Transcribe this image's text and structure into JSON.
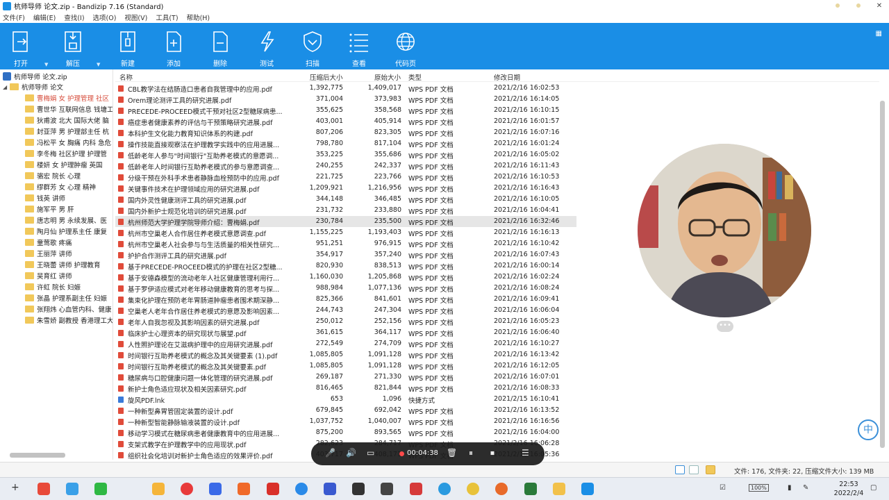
{
  "window": {
    "title": "杭师导师 论文.zip - Bandizip 7.16 (Standard)"
  },
  "menu": [
    "文件(F)",
    "编辑(E)",
    "查找(I)",
    "选项(O)",
    "视图(V)",
    "工具(T)",
    "帮助(H)"
  ],
  "toolbar": {
    "buttons": [
      {
        "label": "打开",
        "icon": "open-icon"
      },
      {
        "label": "解压",
        "icon": "extract-icon"
      },
      {
        "label": "新建",
        "icon": "new-archive-icon"
      },
      {
        "label": "添加",
        "icon": "add-icon"
      },
      {
        "label": "删除",
        "icon": "delete-icon"
      },
      {
        "label": "测试",
        "icon": "test-icon"
      },
      {
        "label": "扫描",
        "icon": "scan-icon"
      },
      {
        "label": "查看",
        "icon": "view-icon"
      },
      {
        "label": "代码页",
        "icon": "codepage-icon"
      }
    ],
    "color": "#1a8ee6"
  },
  "tree": {
    "root": "杭师导师 论文.zip",
    "folder": "杭师导师 论文",
    "items": [
      "曹梅娟 女 护理管理 社区",
      "曹世华 互联网信息 钱塘工",
      "狄甫波 北大 国际大佬 脑",
      "封亚萍 男 护理部主任 杭",
      "冯松平 女 胸痛 内科 急危",
      "李冬梅 社区护理 护理管",
      "楼妍 女 护理肿瘤 英国",
      "骆宏 院长 心理",
      "缪群芳 女 心理 精神",
      "钱英 讲师",
      "施军平 男 肝",
      "唐志明 男 永续发展、医",
      "陶月仙 护理系主任 康复",
      "童莺歌 疼痛",
      "王丽萍 讲师",
      "王晓蕾 讲师 护理教育",
      "吴育红 讲师",
      "许虹 院长 妇娠",
      "张晶 护理系副主任 妇娠",
      "张翔炜 心血管内科、健康",
      "朱雪娇 副教授 香港理工大"
    ]
  },
  "columns": {
    "name": "名称",
    "csize": "压缩后大小",
    "osize": "原始大小",
    "type": "类型",
    "date": "修改日期"
  },
  "files": [
    {
      "name": "CBL教学法在结肠造口患者自我管理中的应用.pdf",
      "csize": "1,392,775",
      "osize": "1,409,017",
      "type": "WPS PDF 文档",
      "date": "2021/2/16 16:02:53"
    },
    {
      "name": "Orem理论测评工具的研究进展.pdf",
      "csize": "371,004",
      "osize": "373,983",
      "type": "WPS PDF 文档",
      "date": "2021/2/16 16:14:05"
    },
    {
      "name": "PRECEDE-PROCEED模式干预对社区2型糖尿病患...",
      "csize": "355,625",
      "osize": "358,568",
      "type": "WPS PDF 文档",
      "date": "2021/2/16 16:10:15"
    },
    {
      "name": "癌症患者健康素养的评估与干预策略研究进展.pdf",
      "csize": "403,001",
      "osize": "405,914",
      "type": "WPS PDF 文档",
      "date": "2021/2/16 16:01:57"
    },
    {
      "name": "本科护生文化能力教育知识体系的构建.pdf",
      "csize": "807,206",
      "osize": "823,305",
      "type": "WPS PDF 文档",
      "date": "2021/2/16 16:07:16"
    },
    {
      "name": "操作技能直接观察法在护理教学实践中的应用进展...",
      "csize": "798,780",
      "osize": "817,104",
      "type": "WPS PDF 文档",
      "date": "2021/2/16 16:01:24"
    },
    {
      "name": "低龄老年人参与\"时间银行\"互助养老模式的意愿调...",
      "csize": "353,225",
      "osize": "355,686",
      "type": "WPS PDF 文档",
      "date": "2021/2/16 16:05:02"
    },
    {
      "name": "低龄老年人时间银行互助养老模式的参与意愿调查...",
      "csize": "240,255",
      "osize": "242,337",
      "type": "WPS PDF 文档",
      "date": "2021/2/16 16:11:43"
    },
    {
      "name": "分级干预在外科手术患者静脉血栓预防中的应用.pdf",
      "csize": "221,725",
      "osize": "223,766",
      "type": "WPS PDF 文档",
      "date": "2021/2/16 16:10:53"
    },
    {
      "name": "关键事件技术在护理领域应用的研究进展.pdf",
      "csize": "1,209,921",
      "osize": "1,216,956",
      "type": "WPS PDF 文档",
      "date": "2021/2/16 16:16:43"
    },
    {
      "name": "国内外灵性健康测评工具的研究进展.pdf",
      "csize": "344,148",
      "osize": "346,485",
      "type": "WPS PDF 文档",
      "date": "2021/2/16 16:10:05"
    },
    {
      "name": "国内外新护士规范化培训的研究进展.pdf",
      "csize": "231,732",
      "osize": "233,880",
      "type": "WPS PDF 文档",
      "date": "2021/2/16 16:04:41"
    },
    {
      "name": "杭州师范大学护理学院导师介绍：曹梅娟.pdf",
      "csize": "230,784",
      "osize": "235,500",
      "type": "WPS PDF 文档",
      "date": "2021/2/16 16:32:46"
    },
    {
      "name": "杭州市空巢老人合作居住养老模式意愿调查.pdf",
      "csize": "1,155,225",
      "osize": "1,193,403",
      "type": "WPS PDF 文档",
      "date": "2021/2/16 16:16:13"
    },
    {
      "name": "杭州市空巢老人社会参与与生活质量的相关性研究...",
      "csize": "951,251",
      "osize": "976,915",
      "type": "WPS PDF 文档",
      "date": "2021/2/16 16:10:42"
    },
    {
      "name": "护护合作测评工具的研究进展.pdf",
      "csize": "354,917",
      "osize": "357,240",
      "type": "WPS PDF 文档",
      "date": "2021/2/16 16:07:43"
    },
    {
      "name": "基于PRECEDE-PROCEED模式的护理在社区2型糖...",
      "csize": "820,930",
      "osize": "838,513",
      "type": "WPS PDF 文档",
      "date": "2021/2/16 16:00:14"
    },
    {
      "name": "基于安德森模型的流动老年人社区健康管理利用行...",
      "csize": "1,160,030",
      "osize": "1,205,868",
      "type": "WPS PDF 文档",
      "date": "2021/2/16 16:02:24"
    },
    {
      "name": "基于罗伊适应模式对老年移动健康教育的思考与探...",
      "csize": "988,984",
      "osize": "1,077,136",
      "type": "WPS PDF 文档",
      "date": "2021/2/16 16:08:24"
    },
    {
      "name": "集束化护理在预防老年胃肠道肿瘤患者围术期深静...",
      "csize": "825,366",
      "osize": "841,601",
      "type": "WPS PDF 文档",
      "date": "2021/2/16 16:09:41"
    },
    {
      "name": "空巢老人老年合作居住养老模式的意愿及影响因素...",
      "csize": "244,743",
      "osize": "247,304",
      "type": "WPS PDF 文档",
      "date": "2021/2/16 16:06:04"
    },
    {
      "name": "老年人自我忽视及其影响因素的研究进展.pdf",
      "csize": "250,012",
      "osize": "252,156",
      "type": "WPS PDF 文档",
      "date": "2021/2/16 16:05:23"
    },
    {
      "name": "临床护士心理资本的研究现状与展望.pdf",
      "csize": "361,615",
      "osize": "364,117",
      "type": "WPS PDF 文档",
      "date": "2021/2/16 16:06:40"
    },
    {
      "name": "人性照护理论在艾滋病护理中的应用研究进展.pdf",
      "csize": "272,549",
      "osize": "274,709",
      "type": "WPS PDF 文档",
      "date": "2021/2/16 16:10:27"
    },
    {
      "name": "时间银行互助养老模式的概念及其关键要素 (1).pdf",
      "csize": "1,085,805",
      "osize": "1,091,128",
      "type": "WPS PDF 文档",
      "date": "2021/2/16 16:13:42"
    },
    {
      "name": "时间银行互助养老模式的概念及其关键要素.pdf",
      "csize": "1,085,805",
      "osize": "1,091,128",
      "type": "WPS PDF 文档",
      "date": "2021/2/16 16:12:05"
    },
    {
      "name": "糖尿病与口腔健康问题一体化管理的研究进展.pdf",
      "csize": "269,187",
      "osize": "271,330",
      "type": "WPS PDF 文档",
      "date": "2021/2/16 16:07:01"
    },
    {
      "name": "新护士角色适应现状及相关因素研究.pdf",
      "csize": "816,465",
      "osize": "821,844",
      "type": "WPS PDF 文档",
      "date": "2021/2/16 16:08:33"
    },
    {
      "name": "旋风PDF.lnk",
      "csize": "653",
      "osize": "1,096",
      "type": "快捷方式",
      "date": "2021/2/15 16:10:41"
    },
    {
      "name": "一种新型鼻胃管固定装置的设计.pdf",
      "csize": "679,845",
      "osize": "692,042",
      "type": "WPS PDF 文档",
      "date": "2021/2/16 16:13:52"
    },
    {
      "name": "一种新型智能静脉输液装置的设计.pdf",
      "csize": "1,037,752",
      "osize": "1,040,007",
      "type": "WPS PDF 文档",
      "date": "2021/2/16 16:16:56"
    },
    {
      "name": "移动学习模式在糖尿病患者健康教育中的应用进展...",
      "csize": "875,200",
      "osize": "893,565",
      "type": "WPS PDF 文档",
      "date": "2021/2/16 16:04:00"
    },
    {
      "name": "支架式教学在护理教学中的应用现状.pdf",
      "csize": "282,623",
      "osize": "284,717",
      "type": "WPS PDF 文档",
      "date": "2021/2/16 16:06:28"
    },
    {
      "name": "组织社会化培训对新护士角色适应的效果评价.pdf",
      "csize": "403,717",
      "osize": "408,171",
      "type": "WPS PDF 文档",
      "date": "2021/2/16 16:05:36"
    }
  ],
  "status": "文件: 176, 文件夹: 22, 压缩文件大小: 139 MB",
  "recorder": {
    "time": "00:04:38"
  },
  "taskbar": {
    "time": "22:53",
    "date": "2022/2/4",
    "battery": "100%"
  }
}
